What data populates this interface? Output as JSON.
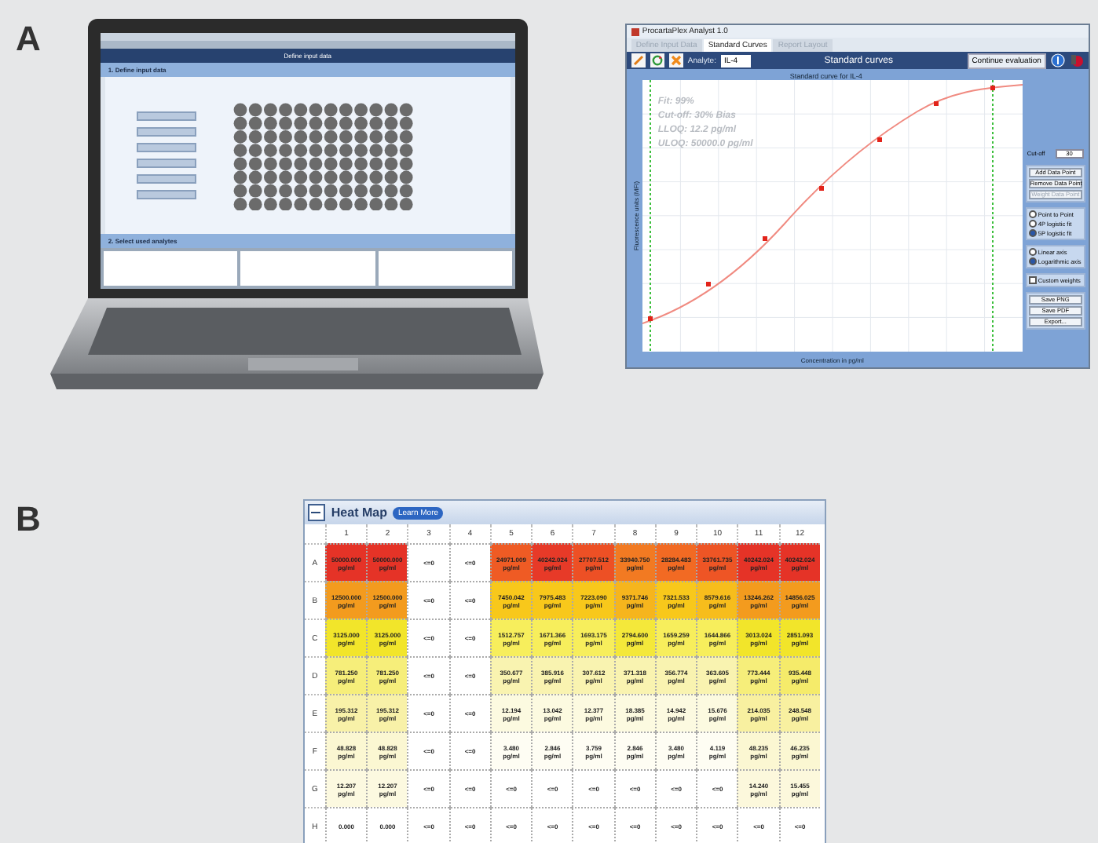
{
  "panels": [
    {
      "label": "A"
    },
    {
      "label": "B"
    }
  ],
  "laptop_app": {
    "title": "Define input data",
    "section_1": "1. Define input data",
    "section_2": "2. Select used analytes"
  },
  "curve_window": {
    "title": "ProcartaPlex Analyst 1.0",
    "tabs": [
      {
        "label": "Define Input Data",
        "selected": false,
        "disabled": true
      },
      {
        "label": "Standard Curves",
        "selected": true,
        "disabled": false
      },
      {
        "label": "Report Layout",
        "selected": false,
        "disabled": true
      }
    ],
    "analyte_label": "Analyte:",
    "analyte": "IL-4",
    "toolbar_title": "Standard curves",
    "continue_button": "Continue evaluation",
    "chart_title": "Standard curve for IL-4",
    "xlabel": "Concentration in pg/ml",
    "ylabel": "Fluorescence units (MFI)",
    "fit_notes": [
      "Fit: 99%",
      "Cut-off: 30% Bias",
      "LLOQ: 12.2 pg/ml",
      "ULOQ: 50000.0 pg/ml"
    ],
    "side_groups": [
      {
        "kind": "field",
        "label": "Cut-off",
        "value": "30"
      },
      {
        "kind": "buttons",
        "items": [
          {
            "label": "Add Data Point",
            "disabled": false
          },
          {
            "label": "Remove Data Point",
            "disabled": false
          },
          {
            "label": "Weight Data Point",
            "disabled": true
          }
        ]
      },
      {
        "kind": "radios",
        "items": [
          {
            "label": "Point to Point",
            "selected": false
          },
          {
            "label": "4P logistic fit",
            "selected": false
          },
          {
            "label": "5P logistic fit",
            "selected": true
          }
        ]
      },
      {
        "kind": "radios",
        "items": [
          {
            "label": "Linear axis",
            "selected": false
          },
          {
            "label": "Logarithmic axis",
            "selected": true
          }
        ]
      },
      {
        "kind": "checks",
        "items": [
          {
            "label": "Custom weights",
            "checked": false
          }
        ]
      },
      {
        "kind": "buttons",
        "items": [
          {
            "label": "Save PNG",
            "disabled": false
          },
          {
            "label": "Save PDF",
            "disabled": false
          },
          {
            "label": "Export...",
            "disabled": false
          }
        ]
      }
    ]
  },
  "heatmap": {
    "title": "Heat Map",
    "learn_more": "Learn More",
    "columns": [
      "1",
      "2",
      "3",
      "4",
      "5",
      "6",
      "7",
      "8",
      "9",
      "10",
      "11",
      "12"
    ],
    "rows": [
      {
        "label": "A",
        "cells": [
          {
            "value": "50000.000",
            "unit": "pg/ml",
            "color": "#e53327"
          },
          {
            "value": "50000.000",
            "unit": "pg/ml",
            "color": "#e53327"
          },
          {
            "value": "<=0",
            "color": "#ffffff"
          },
          {
            "value": "<=0",
            "color": "#ffffff"
          },
          {
            "value": "24971.009",
            "unit": "pg/ml",
            "color": "#ef5b24"
          },
          {
            "value": "40242.024",
            "unit": "pg/ml",
            "color": "#e73a28"
          },
          {
            "value": "27707.512",
            "unit": "pg/ml",
            "color": "#ed5025"
          },
          {
            "value": "33940.750",
            "unit": "pg/ml",
            "color": "#f27a22"
          },
          {
            "value": "28284.483",
            "unit": "pg/ml",
            "color": "#f26a23"
          },
          {
            "value": "33761.735",
            "unit": "pg/ml",
            "color": "#ee5525"
          },
          {
            "value": "40242.024",
            "unit": "pg/ml",
            "color": "#e53327"
          },
          {
            "value": "40242.024",
            "unit": "pg/ml",
            "color": "#e53327"
          }
        ]
      },
      {
        "label": "B",
        "cells": [
          {
            "value": "12500.000",
            "unit": "pg/ml",
            "color": "#f39b1e"
          },
          {
            "value": "12500.000",
            "unit": "pg/ml",
            "color": "#f39b1e"
          },
          {
            "value": "<=0",
            "color": "#ffffff"
          },
          {
            "value": "<=0",
            "color": "#ffffff"
          },
          {
            "value": "7450.042",
            "unit": "pg/ml",
            "color": "#f8c81b"
          },
          {
            "value": "7975.483",
            "unit": "pg/ml",
            "color": "#f8c81b"
          },
          {
            "value": "7223.090",
            "unit": "pg/ml",
            "color": "#f8c81b"
          },
          {
            "value": "9371.746",
            "unit": "pg/ml",
            "color": "#f6b51d"
          },
          {
            "value": "7321.533",
            "unit": "pg/ml",
            "color": "#f8c81b"
          },
          {
            "value": "8579.616",
            "unit": "pg/ml",
            "color": "#f7bd1c"
          },
          {
            "value": "13246.262",
            "unit": "pg/ml",
            "color": "#f39b1e"
          },
          {
            "value": "14856.025",
            "unit": "pg/ml",
            "color": "#f39b1e"
          }
        ]
      },
      {
        "label": "C",
        "cells": [
          {
            "value": "3125.000",
            "unit": "pg/ml",
            "color": "#f2e52a"
          },
          {
            "value": "3125.000",
            "unit": "pg/ml",
            "color": "#f2e52a"
          },
          {
            "value": "<=0",
            "color": "#ffffff"
          },
          {
            "value": "<=0",
            "color": "#ffffff"
          },
          {
            "value": "1512.757",
            "unit": "pg/ml",
            "color": "#f7ee5c"
          },
          {
            "value": "1671.366",
            "unit": "pg/ml",
            "color": "#f7ee5c"
          },
          {
            "value": "1693.175",
            "unit": "pg/ml",
            "color": "#f7ee5c"
          },
          {
            "value": "2794.600",
            "unit": "pg/ml",
            "color": "#f4e83a"
          },
          {
            "value": "1659.259",
            "unit": "pg/ml",
            "color": "#f7ee5c"
          },
          {
            "value": "1644.866",
            "unit": "pg/ml",
            "color": "#f7ee5c"
          },
          {
            "value": "3013.024",
            "unit": "pg/ml",
            "color": "#f2e52a"
          },
          {
            "value": "2851.093",
            "unit": "pg/ml",
            "color": "#f2e52a"
          }
        ]
      },
      {
        "label": "D",
        "cells": [
          {
            "value": "781.250",
            "unit": "pg/ml",
            "color": "#f6ee7a"
          },
          {
            "value": "781.250",
            "unit": "pg/ml",
            "color": "#f6ee7a"
          },
          {
            "value": "<=0",
            "color": "#ffffff"
          },
          {
            "value": "<=0",
            "color": "#ffffff"
          },
          {
            "value": "350.677",
            "unit": "pg/ml",
            "color": "#f9f3b0"
          },
          {
            "value": "385.916",
            "unit": "pg/ml",
            "color": "#f9f3b0"
          },
          {
            "value": "307.612",
            "unit": "pg/ml",
            "color": "#f9f3b0"
          },
          {
            "value": "371.318",
            "unit": "pg/ml",
            "color": "#f9f3b0"
          },
          {
            "value": "356.774",
            "unit": "pg/ml",
            "color": "#f9f3b0"
          },
          {
            "value": "363.605",
            "unit": "pg/ml",
            "color": "#f9f3b0"
          },
          {
            "value": "773.444",
            "unit": "pg/ml",
            "color": "#f6ee7a"
          },
          {
            "value": "935.448",
            "unit": "pg/ml",
            "color": "#f5eb6a"
          }
        ]
      },
      {
        "label": "E",
        "cells": [
          {
            "value": "195.312",
            "unit": "pg/ml",
            "color": "#f8f1a8"
          },
          {
            "value": "195.312",
            "unit": "pg/ml",
            "color": "#f8f1a8"
          },
          {
            "value": "<=0",
            "color": "#ffffff"
          },
          {
            "value": "<=0",
            "color": "#ffffff"
          },
          {
            "value": "12.194",
            "unit": "pg/ml",
            "color": "#fcfae0"
          },
          {
            "value": "13.042",
            "unit": "pg/ml",
            "color": "#fcfae0"
          },
          {
            "value": "12.377",
            "unit": "pg/ml",
            "color": "#fcfae0"
          },
          {
            "value": "18.385",
            "unit": "pg/ml",
            "color": "#fcfae0"
          },
          {
            "value": "14.942",
            "unit": "pg/ml",
            "color": "#fcfae0"
          },
          {
            "value": "15.676",
            "unit": "pg/ml",
            "color": "#fcfae0"
          },
          {
            "value": "214.035",
            "unit": "pg/ml",
            "color": "#f8f0a0"
          },
          {
            "value": "248.548",
            "unit": "pg/ml",
            "color": "#f8f0a0"
          }
        ]
      },
      {
        "label": "F",
        "cells": [
          {
            "value": "48.828",
            "unit": "pg/ml",
            "color": "#fbf7d2"
          },
          {
            "value": "48.828",
            "unit": "pg/ml",
            "color": "#fbf7d2"
          },
          {
            "value": "<=0",
            "color": "#ffffff"
          },
          {
            "value": "<=0",
            "color": "#ffffff"
          },
          {
            "value": "3.480",
            "unit": "pg/ml",
            "color": "#fefdf3"
          },
          {
            "value": "2.846",
            "unit": "pg/ml",
            "color": "#fefdf3"
          },
          {
            "value": "3.759",
            "unit": "pg/ml",
            "color": "#fefdf3"
          },
          {
            "value": "2.846",
            "unit": "pg/ml",
            "color": "#fefdf3"
          },
          {
            "value": "3.480",
            "unit": "pg/ml",
            "color": "#fefdf3"
          },
          {
            "value": "4.119",
            "unit": "pg/ml",
            "color": "#fefdf3"
          },
          {
            "value": "48.235",
            "unit": "pg/ml",
            "color": "#fbf7d2"
          },
          {
            "value": "46.235",
            "unit": "pg/ml",
            "color": "#fbf7d2"
          }
        ]
      },
      {
        "label": "G",
        "cells": [
          {
            "value": "12.207",
            "unit": "pg/ml",
            "color": "#fcf9e0"
          },
          {
            "value": "12.207",
            "unit": "pg/ml",
            "color": "#fcf9e0"
          },
          {
            "value": "<=0",
            "color": "#ffffff"
          },
          {
            "value": "<=0",
            "color": "#ffffff"
          },
          {
            "value": "<=0",
            "color": "#ffffff"
          },
          {
            "value": "<=0",
            "color": "#ffffff"
          },
          {
            "value": "<=0",
            "color": "#ffffff"
          },
          {
            "value": "<=0",
            "color": "#ffffff"
          },
          {
            "value": "<=0",
            "color": "#ffffff"
          },
          {
            "value": "<=0",
            "color": "#ffffff"
          },
          {
            "value": "14.240",
            "unit": "pg/ml",
            "color": "#fcf8dc"
          },
          {
            "value": "15.455",
            "unit": "pg/ml",
            "color": "#fcf8dc"
          }
        ]
      },
      {
        "label": "H",
        "cells": [
          {
            "value": "0.000",
            "color": "#ffffff"
          },
          {
            "value": "0.000",
            "color": "#ffffff"
          },
          {
            "value": "<=0",
            "color": "#ffffff"
          },
          {
            "value": "<=0",
            "color": "#ffffff"
          },
          {
            "value": "<=0",
            "color": "#ffffff"
          },
          {
            "value": "<=0",
            "color": "#ffffff"
          },
          {
            "value": "<=0",
            "color": "#ffffff"
          },
          {
            "value": "<=0",
            "color": "#ffffff"
          },
          {
            "value": "<=0",
            "color": "#ffffff"
          },
          {
            "value": "<=0",
            "color": "#ffffff"
          },
          {
            "value": "<=0",
            "color": "#ffffff"
          },
          {
            "value": "<=0",
            "color": "#ffffff"
          }
        ]
      }
    ]
  }
}
